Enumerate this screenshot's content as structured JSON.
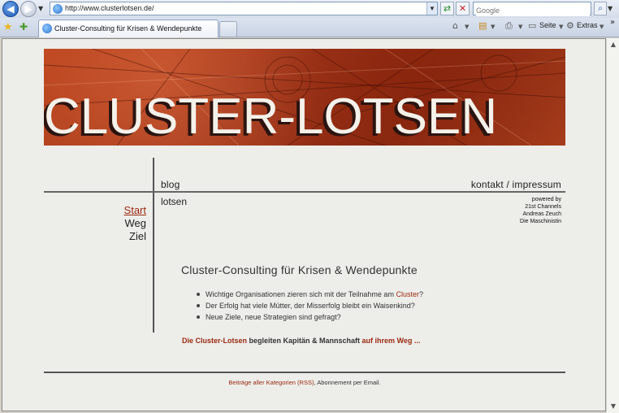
{
  "browser": {
    "url": "http://www.clusterlotsen.de/",
    "search_placeholder": "Google",
    "tab_title": "Cluster-Consulting für Krisen & Wendepunkte",
    "commands": {
      "page_label": "Seite",
      "extras_label": "Extras"
    }
  },
  "banner": {
    "title": "CLUSTER-LOTSEN"
  },
  "top_nav": {
    "blog": "blog",
    "kontakt": "kontakt / impressum",
    "lotsen": "lotsen"
  },
  "powered_by": [
    "powered by",
    "21st Channels",
    "Andreas Zeuch",
    "Die Maschinistin"
  ],
  "side_menu": [
    {
      "label": "Start",
      "active": true
    },
    {
      "label": "Weg",
      "active": false
    },
    {
      "label": "Ziel",
      "active": false
    }
  ],
  "main": {
    "headline": "Cluster-Consulting für Krisen & Wendepunkte",
    "bullets": [
      {
        "text": "Wichtige Organisationen zieren sich mit der Teilnahme am ",
        "link": "Cluster",
        "suffix": "?"
      },
      {
        "text": "Der Erfolg hat viele Mütter, der Misserfolg bleibt ein Waisenkind?"
      },
      {
        "text": "Neue Ziele, neue Strategien sind gefragt?"
      }
    ],
    "tagline": {
      "link1": "Die Cluster-Lotsen",
      "middle": " begleiten Kapitän & Mannschaft ",
      "link2": "auf ihrem Weg",
      "ellipsis": "  ..."
    }
  },
  "footer": {
    "link": "Beiträge aller Kategorien (RSS)",
    "rest": ", Abonnement per Email."
  },
  "colors": {
    "accent": "#9a2a10",
    "banner": "#a53c1b"
  }
}
